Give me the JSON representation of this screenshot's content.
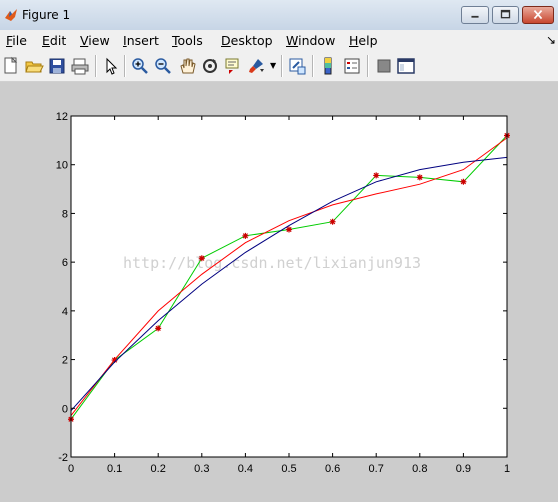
{
  "window": {
    "title": "Figure 1"
  },
  "menu": [
    {
      "label": "File",
      "ul": "F",
      "rest": "ile"
    },
    {
      "label": "Edit",
      "ul": "E",
      "rest": "dit"
    },
    {
      "label": "View",
      "ul": "V",
      "rest": "iew"
    },
    {
      "label": "Insert",
      "ul": "I",
      "rest": "nsert"
    },
    {
      "label": "Tools",
      "ul": "T",
      "rest": "ools"
    },
    {
      "label": "Desktop",
      "ul": "D",
      "rest": "esktop"
    },
    {
      "label": "Window",
      "ul": "W",
      "rest": "indow"
    },
    {
      "label": "Help",
      "ul": "H",
      "rest": "elp"
    }
  ],
  "toolbar_icons": [
    "new-figure-icon",
    "open-file-icon",
    "save-icon",
    "print-icon",
    "pointer-icon",
    "zoom-in-icon",
    "zoom-out-icon",
    "pan-hand-icon",
    "rotate-3d-icon",
    "data-cursor-icon",
    "brush-icon",
    "link-plot-icon",
    "colorbar-icon",
    "legend-icon",
    "hide-plot-tools-icon",
    "show-plot-tools-icon"
  ],
  "watermark": "http://blog.csdn.net/lixianjun913",
  "chart_data": {
    "type": "line",
    "xlim": [
      0,
      1
    ],
    "ylim": [
      -2,
      12
    ],
    "x_ticks": [
      "0",
      "0.1",
      "0.2",
      "0.3",
      "0.4",
      "0.5",
      "0.6",
      "0.7",
      "0.8",
      "0.9",
      "1"
    ],
    "y_ticks": [
      "-2",
      "0",
      "2",
      "4",
      "6",
      "8",
      "10",
      "12"
    ],
    "grid": false,
    "series": [
      {
        "color": "#00cc00",
        "marker": "*",
        "marker_color": "#cc0000",
        "x": [
          0,
          0.1,
          0.2,
          0.3,
          0.4,
          0.5,
          0.6,
          0.7,
          0.8,
          0.9,
          1.0
        ],
        "y": [
          -0.45,
          1.98,
          3.28,
          6.16,
          7.08,
          7.34,
          7.66,
          9.56,
          9.48,
          9.3,
          11.2
        ]
      },
      {
        "color": "#ff0000",
        "x": [
          0,
          0.1,
          0.2,
          0.3,
          0.4,
          0.5,
          0.6,
          0.7,
          0.8,
          0.9,
          1.0
        ],
        "y": [
          -0.3,
          2.0,
          4.0,
          5.5,
          6.8,
          7.7,
          8.35,
          8.8,
          9.2,
          9.8,
          11.1
        ]
      },
      {
        "color": "#000080",
        "x": [
          0,
          0.1,
          0.2,
          0.3,
          0.4,
          0.5,
          0.6,
          0.7,
          0.8,
          0.9,
          1.0
        ],
        "y": [
          -0.1,
          1.9,
          3.6,
          5.1,
          6.4,
          7.5,
          8.5,
          9.3,
          9.8,
          10.1,
          10.3
        ]
      }
    ]
  }
}
